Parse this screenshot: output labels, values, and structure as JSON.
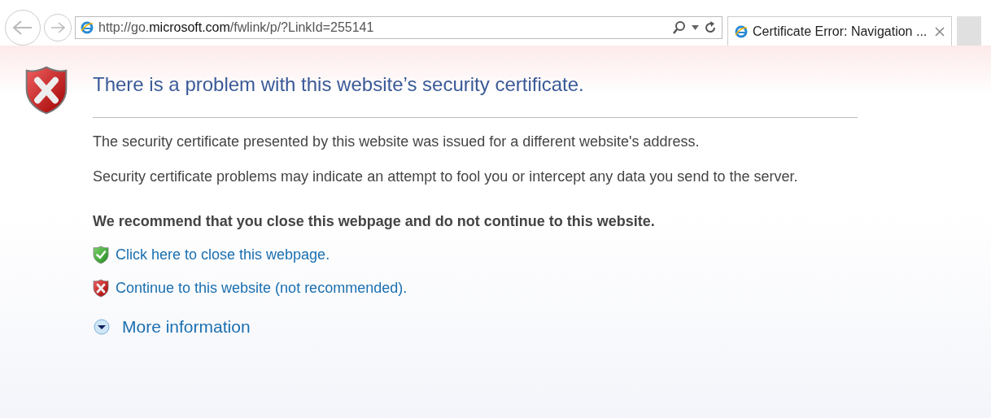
{
  "browser": {
    "address": "http://go.**microsoft.com**/fwlink/p/?LinkId=255141",
    "tab": {
      "title": "Certificate Error: Navigation ...",
      "selected": true
    }
  },
  "page": {
    "title": "There is a problem with this website’s security certificate.",
    "paragraphs": [
      "The security certificate presented by this website was issued for a different website's address.",
      "Security certificate problems may indicate an attempt to fool you or intercept any data you send to the server."
    ],
    "recommendation": "We recommend that you close this webpage and do not continue to this website.",
    "links": [
      {
        "kind": "safe",
        "label": "Click here to close this webpage."
      },
      {
        "kind": "unsafe",
        "label": "Continue to this website (not recommended)."
      }
    ],
    "more_info": {
      "label": "More information",
      "expanded": false
    }
  }
}
